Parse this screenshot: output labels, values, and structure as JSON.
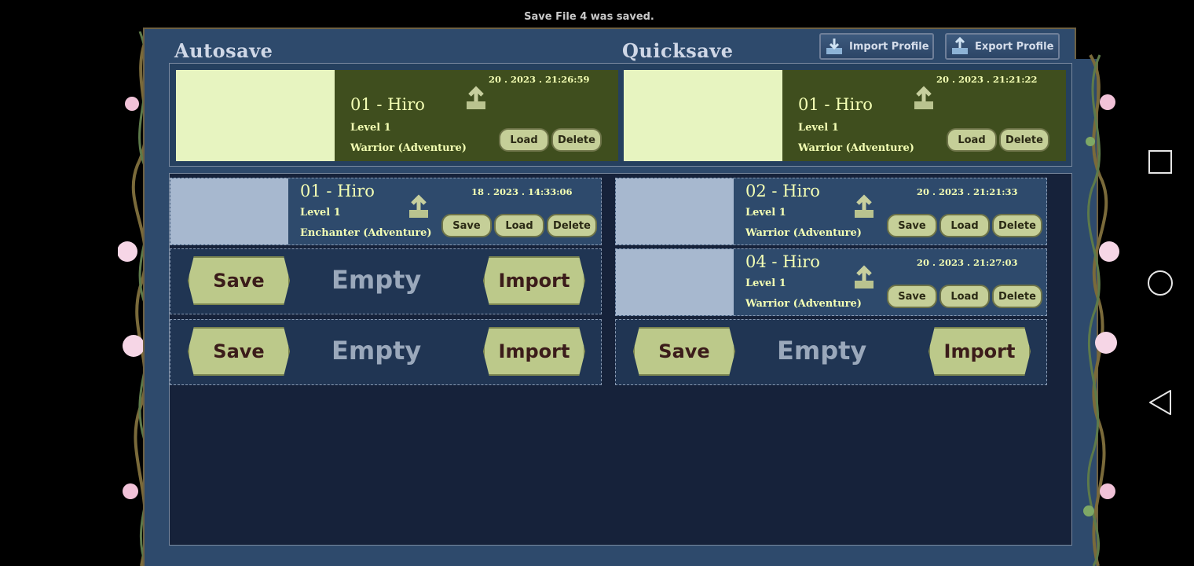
{
  "toast": "Save File 4 was saved.",
  "titles": {
    "autosave": "Autosave",
    "quicksave": "Quicksave"
  },
  "profile": {
    "import": "Import Profile",
    "export": "Export Profile"
  },
  "labels": {
    "save": "Save",
    "load": "Load",
    "delete": "Delete",
    "import": "Import",
    "empty": "Empty"
  },
  "autosave": {
    "name": "01 - Hiro",
    "level": "Level 1",
    "class": "Warrior (Adventure)",
    "date": "20 . 2023 . 21:26:59"
  },
  "quicksave": {
    "name": "01 - Hiro",
    "level": "Level 1",
    "class": "Warrior (Adventure)",
    "date": "20 . 2023 . 21:21:22"
  },
  "slots": [
    {
      "name": "01 - Hiro",
      "level": "Level 1",
      "class": "Enchanter (Adventure)",
      "date": "18 . 2023 . 14:33:06"
    },
    {
      "name": "02 - Hiro",
      "level": "Level 1",
      "class": "Warrior (Adventure)",
      "date": "20 . 2023 . 21:21:33"
    },
    {
      "name": "04 - Hiro",
      "level": "Level 1",
      "class": "Warrior (Adventure)",
      "date": "20 . 2023 . 21:27:03"
    }
  ],
  "colors": {
    "accent": "#f4ffb4",
    "panel": "#2e4a6c",
    "button": "#c5cf98"
  },
  "icons": {
    "upload": "upload-icon",
    "import_profile": "download-icon",
    "export_profile": "upload-icon"
  }
}
